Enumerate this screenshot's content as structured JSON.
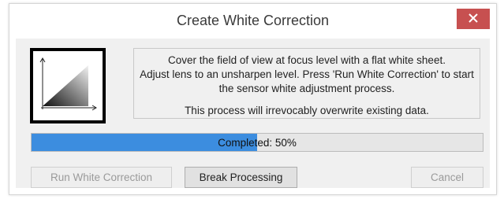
{
  "dialog": {
    "title": "Create White Correction",
    "close_label": "✕"
  },
  "message": {
    "lines": [
      "Cover the field of view at focus level with a flat white sheet.",
      "Adjust lens to an unsharpen level. Press 'Run White Correction' to start",
      "the sensor white adjustment process."
    ],
    "warning": "This process will irrevocably overwrite existing data."
  },
  "progress": {
    "label": "Completed: 50%",
    "value": 0.5,
    "fill_color": "#3c8ddf"
  },
  "buttons": {
    "run": "Run White Correction",
    "break": "Break Processing",
    "cancel": "Cancel"
  },
  "icons": {
    "logo": "white-correction-gradient-icon",
    "close": "close-icon"
  },
  "colors": {
    "close_button": "#c75050"
  }
}
